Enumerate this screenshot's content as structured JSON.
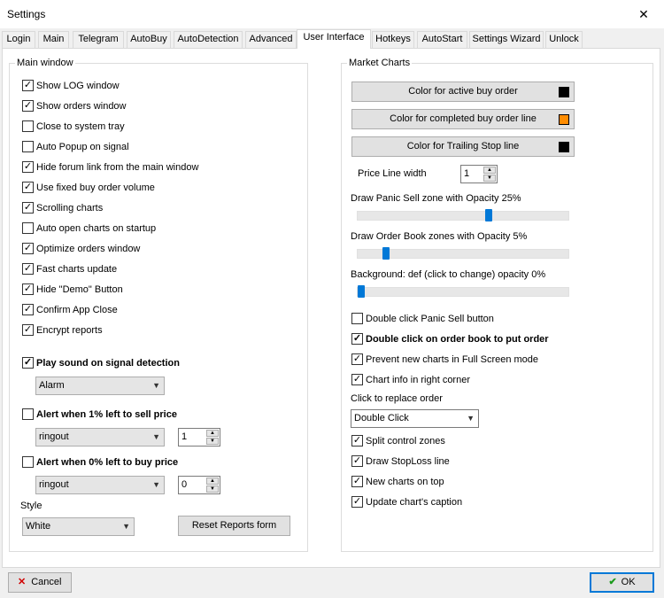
{
  "window": {
    "title": "Settings",
    "close_glyph": "✕"
  },
  "tabs": [
    "Login",
    "Main",
    "Telegram",
    "AutoBuy",
    "AutoDetection",
    "Advanced",
    "User Interface",
    "Hotkeys",
    "AutoStart",
    "Settings Wizard",
    "Unlock"
  ],
  "main_window": {
    "title": "Main window",
    "options": [
      {
        "label": "Show LOG window",
        "checked": true
      },
      {
        "label": "Show orders window",
        "checked": true
      },
      {
        "label": "Close to system tray",
        "checked": false
      },
      {
        "label": "Auto Popup on signal",
        "checked": false
      },
      {
        "label": "Hide forum link from the main window",
        "checked": true
      },
      {
        "label": "Use fixed buy order volume",
        "checked": true
      },
      {
        "label": "Scrolling charts",
        "checked": true
      },
      {
        "label": "Auto open charts on startup",
        "checked": false
      },
      {
        "label": "Optimize orders window",
        "checked": true
      },
      {
        "label": "Fast charts update",
        "checked": true
      },
      {
        "label": "Hide \"Demo\" Button",
        "checked": true
      },
      {
        "label": "Confirm App Close",
        "checked": true
      },
      {
        "label": "Encrypt reports",
        "checked": true
      }
    ],
    "play_sound": {
      "label": "Play sound on signal detection",
      "checked": true,
      "sound": "Alarm"
    },
    "alert_sell": {
      "label": "Alert when 1% left to sell price",
      "checked": false,
      "sound": "ringout",
      "value": "1"
    },
    "alert_buy": {
      "label": "Alert when 0% left to buy price",
      "checked": false,
      "sound": "ringout",
      "value": "0"
    },
    "style_label": "Style",
    "style_value": "White",
    "reset_button": "Reset Reports form"
  },
  "market_charts": {
    "title": "Market Charts",
    "color_buttons": [
      {
        "label": "Color for active buy order",
        "color": "#000000"
      },
      {
        "label": "Color for completed buy order line",
        "color": "#ff8c00"
      },
      {
        "label": "Color for Trailing Stop line",
        "color": "#000000"
      }
    ],
    "price_line_width_label": "Price Line width",
    "price_line_width": "1",
    "sliders": [
      {
        "label": "Draw Panic Sell zone with Opacity 25%",
        "value": 0.6
      },
      {
        "label": "Draw Order Book zones with Opacity 5%",
        "value": 0.12
      },
      {
        "label": "Background: def (click to change) opacity 0%",
        "value": 0.0
      }
    ],
    "options_a": [
      {
        "label": "Double click Panic Sell button",
        "checked": false,
        "bold": false
      },
      {
        "label": "Double click on order book to put order",
        "checked": true,
        "bold": true
      },
      {
        "label": "Prevent new charts in Full Screen mode",
        "checked": true,
        "bold": false
      },
      {
        "label": "Chart info in right corner",
        "checked": true,
        "bold": false
      }
    ],
    "click_replace_label": "Click to replace order",
    "click_replace_value": "Double Click",
    "options_b": [
      {
        "label": "Split control zones",
        "checked": true
      },
      {
        "label": "Draw StopLoss line",
        "checked": true
      },
      {
        "label": "New charts on top",
        "checked": true
      },
      {
        "label": "Update chart's caption",
        "checked": true
      }
    ]
  },
  "footer": {
    "cancel": "Cancel",
    "ok": "OK"
  },
  "icons": {
    "check": "✓",
    "cancel": "✕",
    "ok": "✔",
    "dropdown": "▼",
    "spin_up": "▲",
    "spin_down": "▼"
  }
}
